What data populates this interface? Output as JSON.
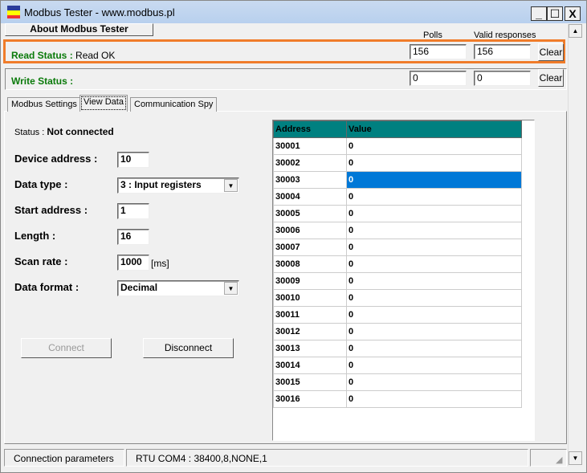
{
  "window": {
    "title": "Modbus Tester - www.modbus.pl",
    "minimize": "_",
    "maximize": "☐",
    "close": "X"
  },
  "toolbar": {
    "about_label": "About Modbus Tester"
  },
  "read": {
    "label": "Read Status",
    "sep": " : ",
    "value": "Read OK",
    "polls_header": "Polls",
    "valid_header": "Valid responses",
    "polls": "156",
    "valid": "156",
    "clear": "Clear"
  },
  "write": {
    "label": "Write Status :",
    "polls": "0",
    "valid": "0",
    "clear": "Clear"
  },
  "tabs": [
    {
      "label": "Modbus Settings"
    },
    {
      "label": "View Data"
    },
    {
      "label": "Communication Spy"
    }
  ],
  "form": {
    "status_label": "Status : ",
    "status_value": "Not connected",
    "device_address_label": "Device address :",
    "device_address": "10",
    "data_type_label": "Data type :",
    "data_type": "3 : Input registers",
    "start_address_label": "Start address :",
    "start_address": "1",
    "length_label": "Length :",
    "length": "16",
    "scan_rate_label": "Scan rate :",
    "scan_rate": "1000",
    "scan_rate_unit": "[ms]",
    "data_format_label": "Data format :",
    "data_format": "Decimal",
    "connect": "Connect",
    "disconnect": "Disconnect"
  },
  "table": {
    "headers": [
      "Address",
      "Value"
    ],
    "selected_row": 2,
    "rows": [
      [
        "30001",
        "0"
      ],
      [
        "30002",
        "0"
      ],
      [
        "30003",
        "0"
      ],
      [
        "30004",
        "0"
      ],
      [
        "30005",
        "0"
      ],
      [
        "30006",
        "0"
      ],
      [
        "30007",
        "0"
      ],
      [
        "30008",
        "0"
      ],
      [
        "30009",
        "0"
      ],
      [
        "30010",
        "0"
      ],
      [
        "30011",
        "0"
      ],
      [
        "30012",
        "0"
      ],
      [
        "30013",
        "0"
      ],
      [
        "30014",
        "0"
      ],
      [
        "30015",
        "0"
      ],
      [
        "30016",
        "0"
      ]
    ]
  },
  "statusbar": {
    "left": "Connection parameters",
    "right": "RTU  COM4 : 38400,8,NONE,1"
  },
  "colors": {
    "accent": "#008080",
    "selection": "#0078d7",
    "highlight": "#f07c2a",
    "status_green": "#0a7a0a"
  }
}
